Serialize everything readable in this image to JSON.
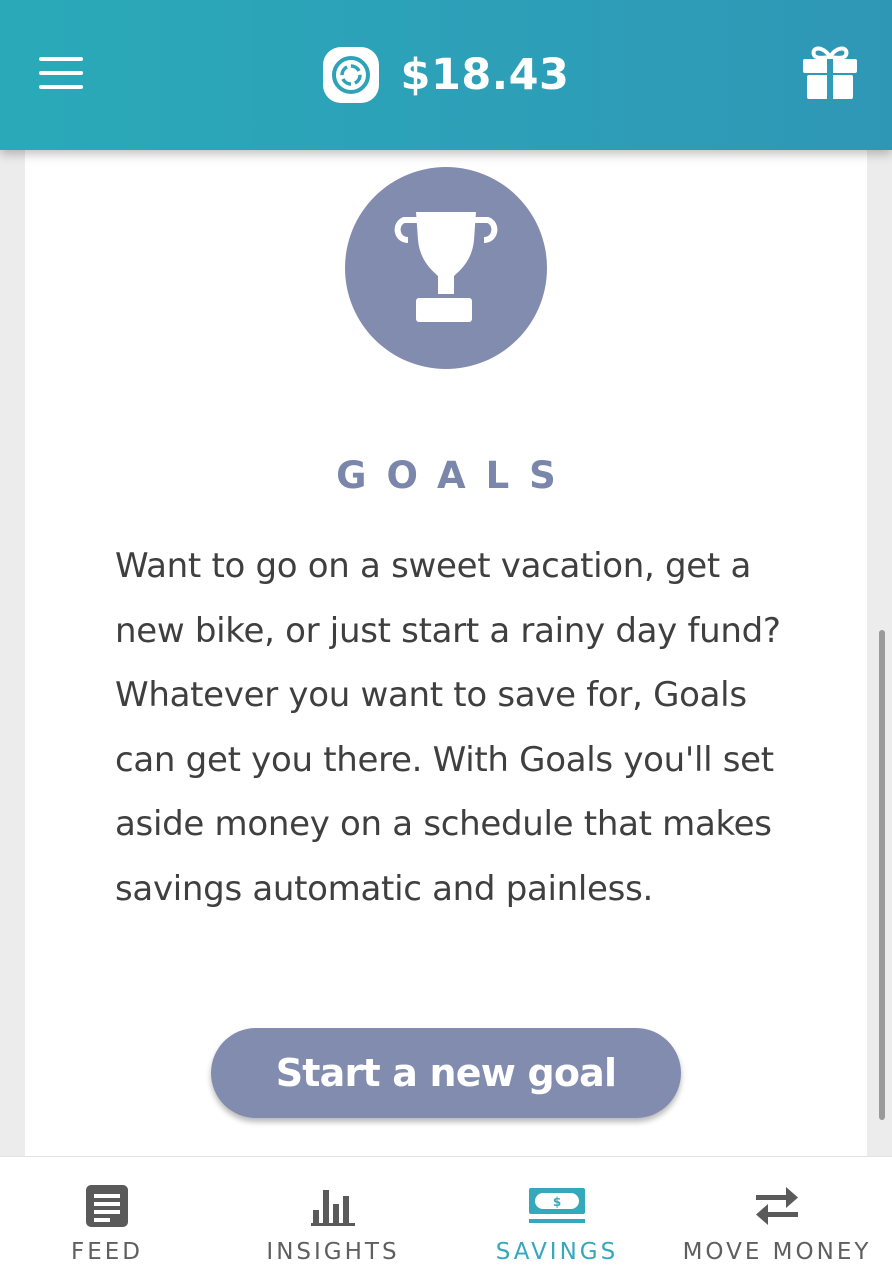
{
  "header": {
    "balance": "$18.43",
    "menu_icon": "hamburger-menu-icon",
    "balance_icon": "coin-icon",
    "gift_icon": "gift-icon",
    "gradient_start": "#2aaab9",
    "gradient_end": "#2f97b6"
  },
  "card": {
    "icon": "trophy-icon",
    "title": "GOALS",
    "description": "Want to go on a sweet vacation, get a new bike, or just start a rainy day fund? Whatever you want to save for, Goals can get you there. With Goals you'll set aside money on a schedule that makes savings automatic and painless.",
    "button_label": "Start a new goal",
    "accent_color": "#828caf"
  },
  "bottom_nav": {
    "active_color": "#36a8bc",
    "inactive_color": "#5f5f5f",
    "items": [
      {
        "label": "FEED",
        "icon": "feed-icon",
        "active": false
      },
      {
        "label": "INSIGHTS",
        "icon": "bar-chart-icon",
        "active": false
      },
      {
        "label": "SAVINGS",
        "icon": "cash-icon",
        "active": true
      },
      {
        "label": "MOVE MONEY",
        "icon": "transfer-arrows-icon",
        "active": false
      }
    ]
  }
}
